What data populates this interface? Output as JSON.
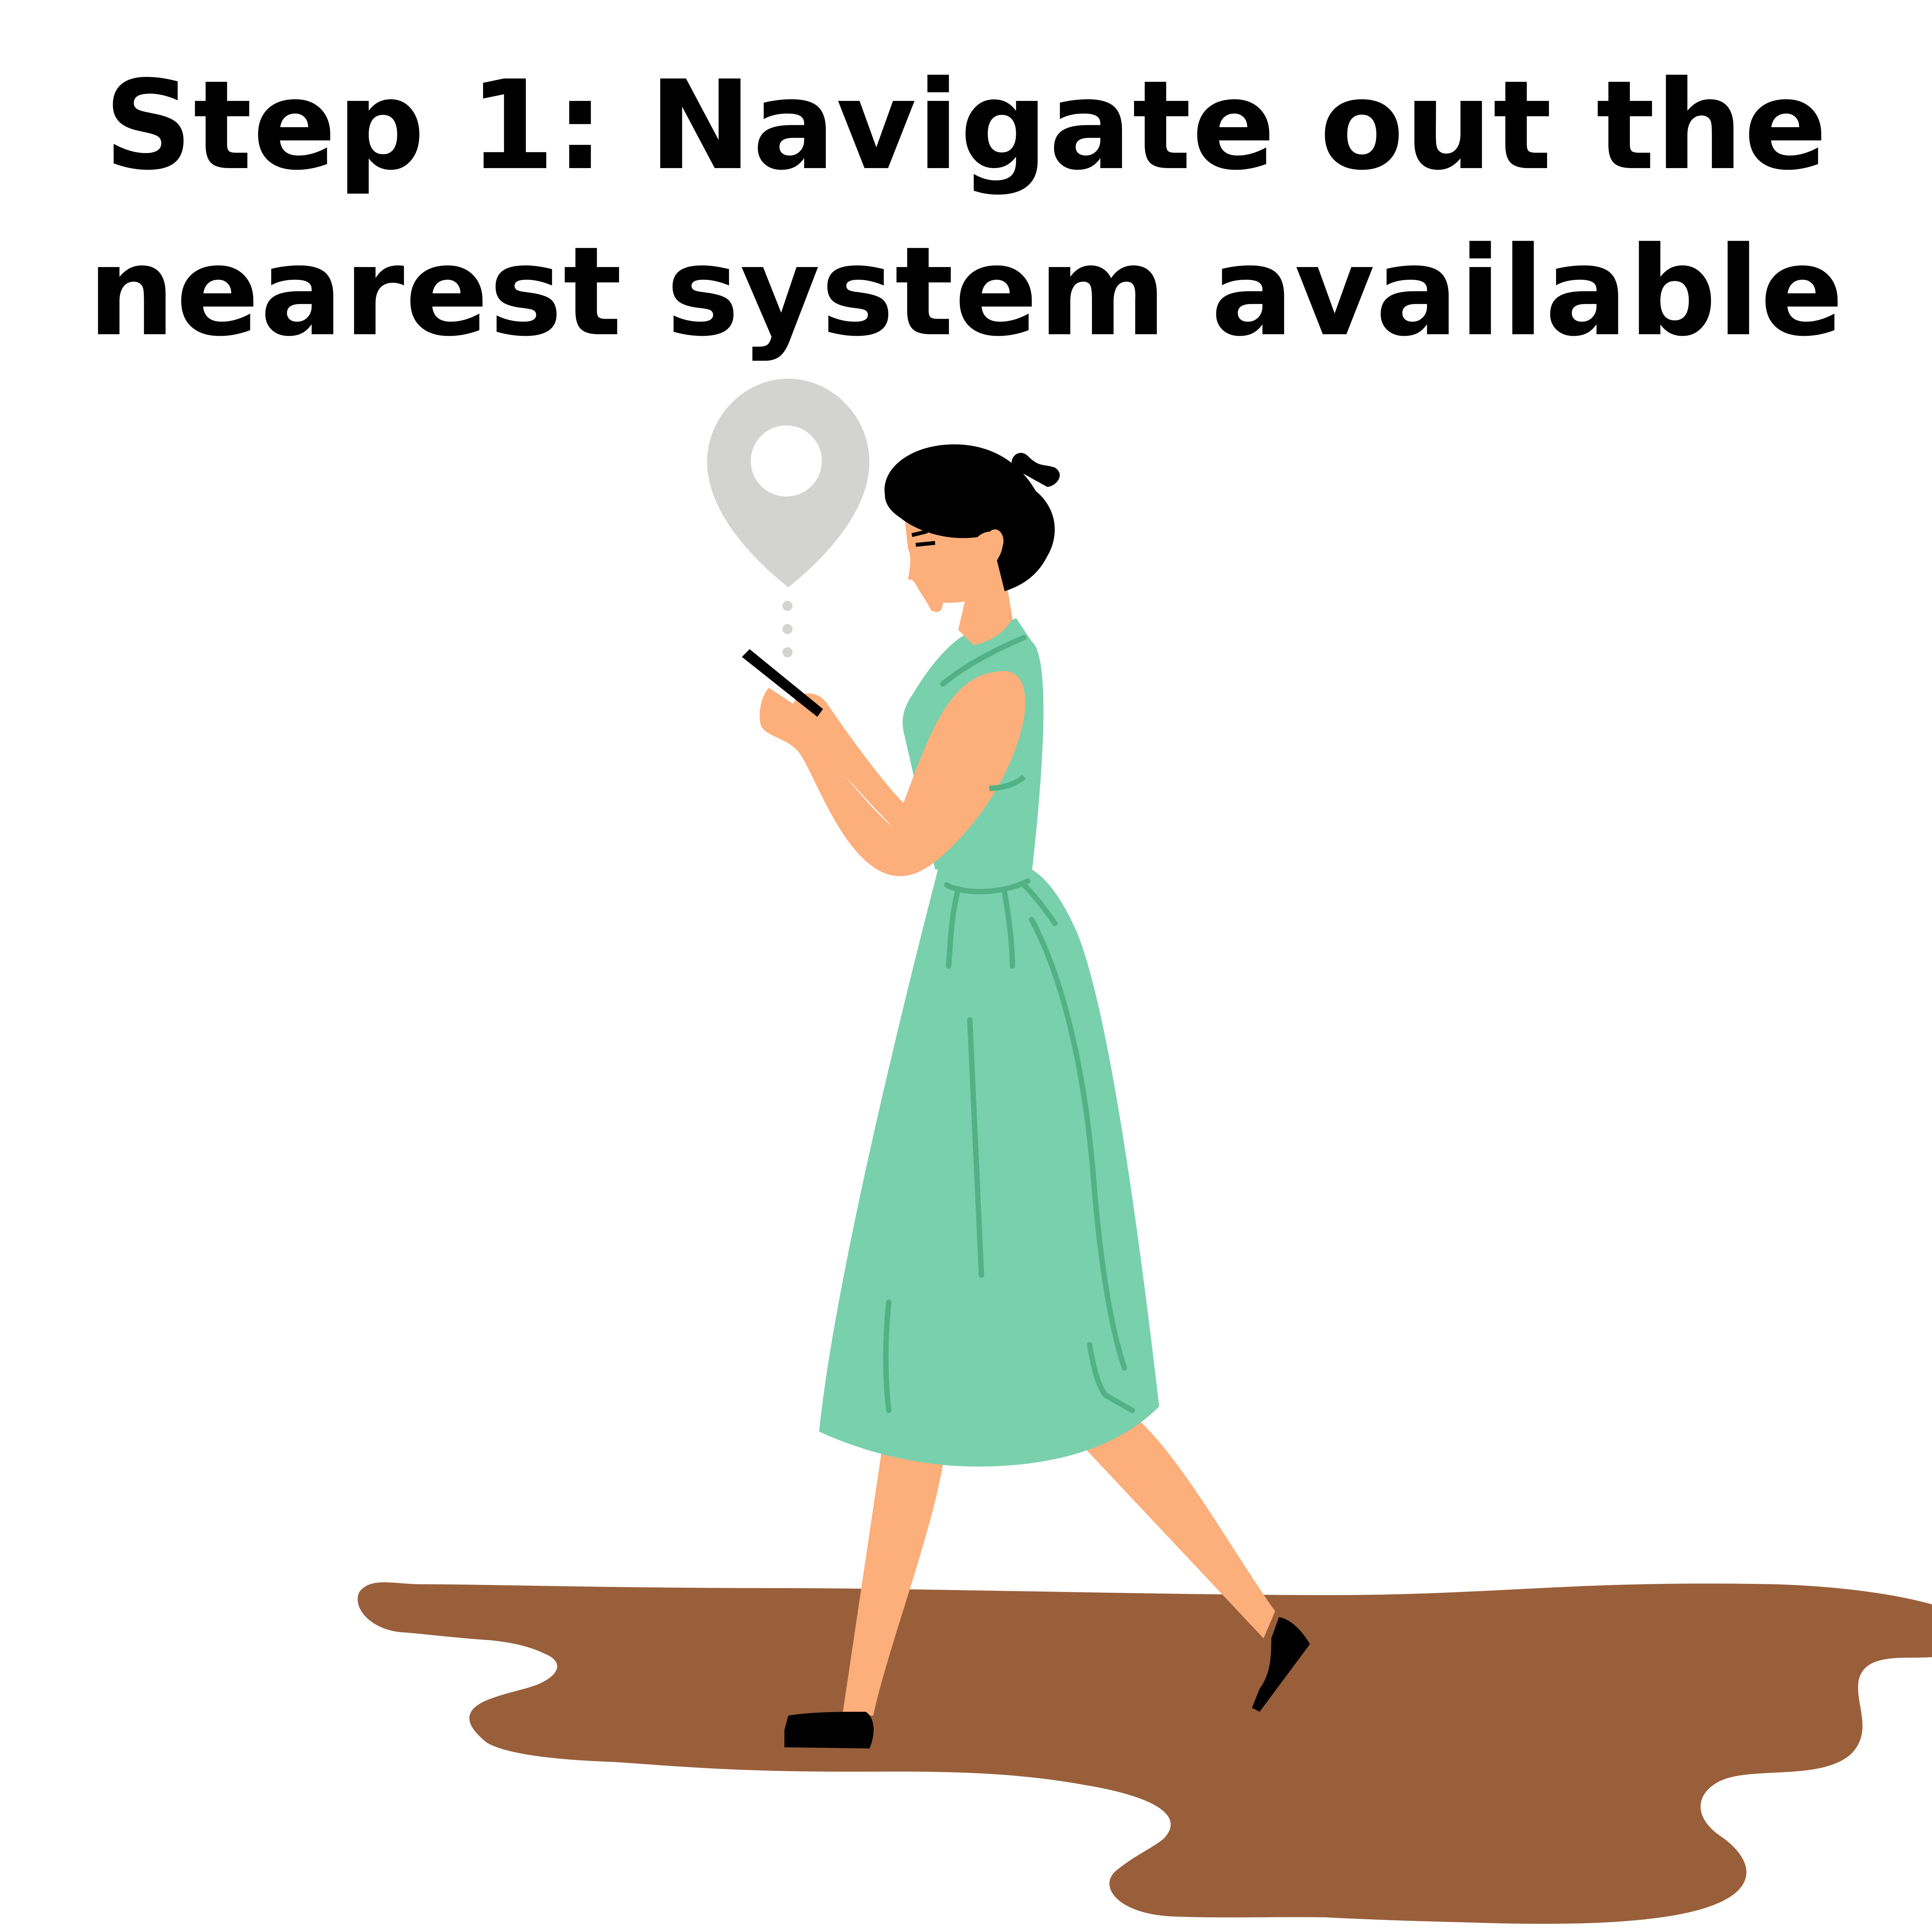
{
  "title": {
    "line1": "Step 1: Navigate out the",
    "line2": "nearest system available"
  },
  "colors": {
    "background": "#ffffff",
    "text": "#000000",
    "dress": "#79d0ad",
    "dress_shade": "#52b286",
    "skin": "#fcae7b",
    "hair": "#000000",
    "pin": "#d3d3d1",
    "puddle": "#995f3b"
  },
  "icons": {
    "location": "location-pin-icon",
    "phone": "smartphone-icon"
  }
}
